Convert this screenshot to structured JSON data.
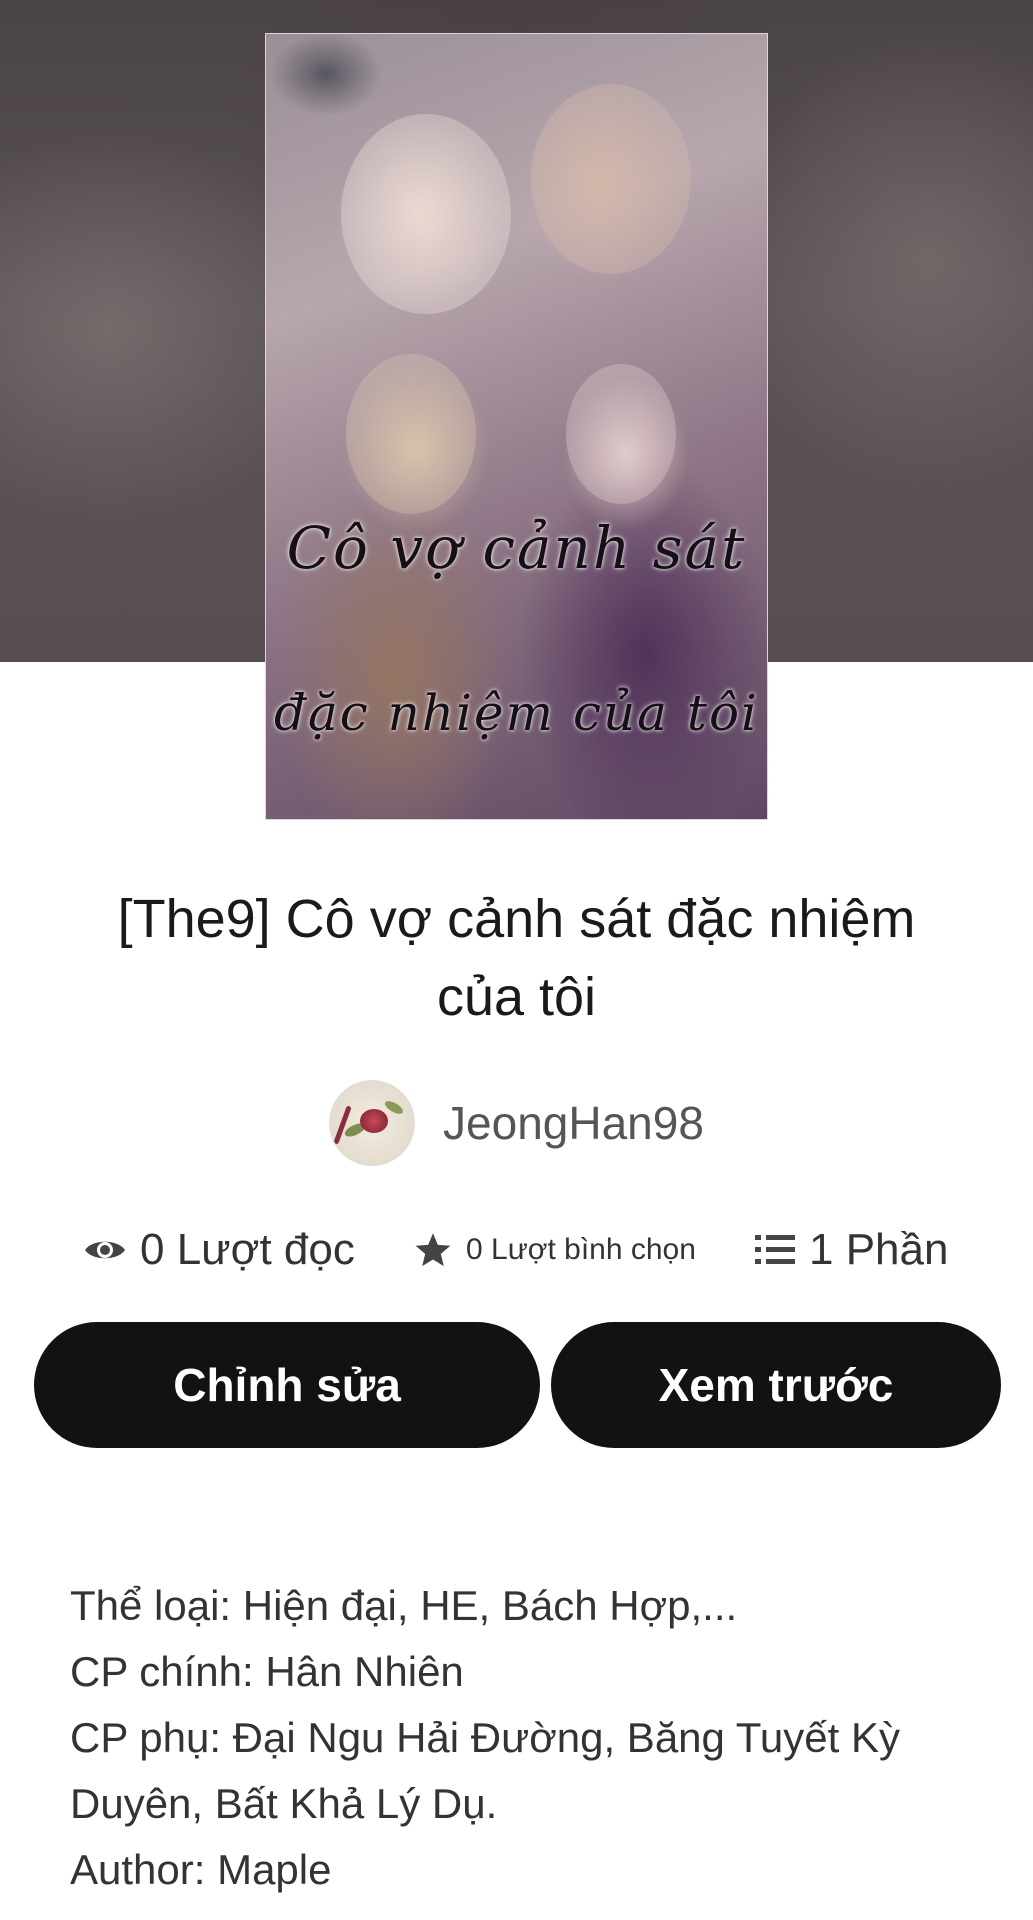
{
  "cover": {
    "text_line1": "Cô vợ cảnh sát",
    "text_line2": "đặc nhiệm của tôi"
  },
  "book": {
    "title_line1": "[The9] Cô vợ cảnh sát đặc nhiệm",
    "title_line2": "của tôi"
  },
  "author": {
    "name": "JeongHan98"
  },
  "stats": {
    "reads": "0 Lượt đọc",
    "votes": "0 Lượt bình chọn",
    "parts": "1 Phần"
  },
  "buttons": {
    "edit_label": "Chỉnh sửa",
    "preview_label": "Xem trước"
  },
  "description": {
    "lines": [
      "Thể loại: Hiện đại, HE, Bách Hợp,...",
      "CP chính: Hân Nhiên",
      "CP phụ: Đại Ngu Hải Đường, Băng Tuyết Kỳ",
      "Duyên, Bất Khả Lý Dụ.",
      "Author: Maple"
    ]
  },
  "colors": {
    "button_bg": "#121212",
    "button_text": "#ffffff",
    "text_primary": "#1a1a1a",
    "text_secondary": "#555555"
  },
  "icons": {
    "reads": "eye-icon",
    "votes": "star-icon",
    "parts": "list-icon"
  }
}
